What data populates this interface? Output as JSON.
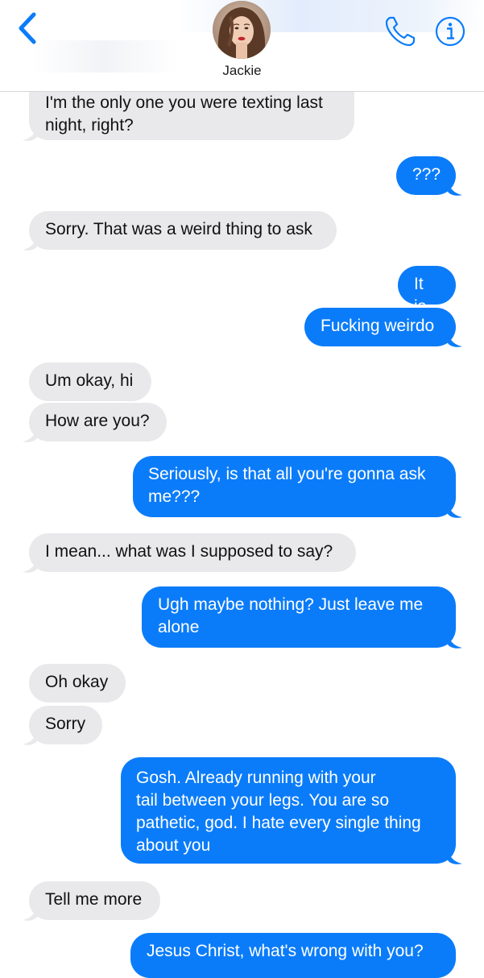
{
  "header": {
    "contact_name": "Jackie",
    "icons": {
      "back": "chevron-left-icon",
      "call": "phone-icon",
      "info": "info-icon"
    }
  },
  "colors": {
    "incoming_bubble": "#e9e9eb",
    "outgoing_bubble": "#0b7cf9",
    "accent": "#0b7cf9"
  },
  "messages": [
    {
      "direction": "incoming",
      "text": "I'm the only one you were texting last\nnight, right?"
    },
    {
      "direction": "outgoing",
      "text": "???"
    },
    {
      "direction": "incoming",
      "text": "Sorry. That was a weird thing to ask"
    },
    {
      "direction": "outgoing",
      "text": "It is"
    },
    {
      "direction": "outgoing",
      "text": "Fucking weirdo"
    },
    {
      "direction": "incoming",
      "text": "Um okay, hi"
    },
    {
      "direction": "incoming",
      "text": "How are you?"
    },
    {
      "direction": "outgoing",
      "text": "Seriously, is that all you're gonna ask\nme???"
    },
    {
      "direction": "incoming",
      "text": "I mean... what was I supposed to say?"
    },
    {
      "direction": "outgoing",
      "text": "Ugh maybe nothing? Just leave me\nalone"
    },
    {
      "direction": "incoming",
      "text": "Oh okay"
    },
    {
      "direction": "incoming",
      "text": "Sorry"
    },
    {
      "direction": "outgoing",
      "text": "Gosh. Already running with your\ntail between your legs. You are so\npathetic, god. I hate every single thing\nabout you"
    },
    {
      "direction": "incoming",
      "text": "Tell me more"
    },
    {
      "direction": "outgoing",
      "text": "Jesus Christ, what's wrong with you?"
    }
  ]
}
